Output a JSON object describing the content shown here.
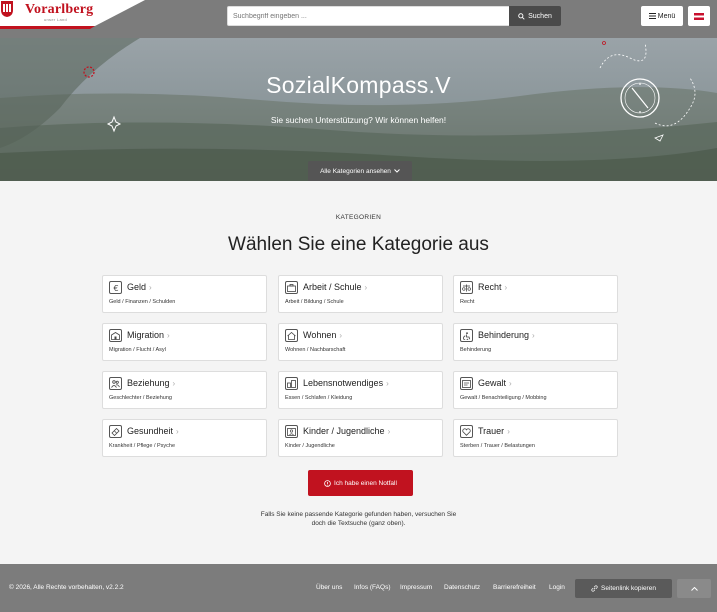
{
  "header": {
    "logo_text": "Vorarlberg",
    "logo_sub": "unser Land",
    "search_placeholder": "Suchbegriff eingeben ...",
    "search_button": "Suchen",
    "menu_label": "Menü"
  },
  "hero": {
    "title": "SozialKompass.V",
    "subtitle": "Sie suchen Unterstützung? Wir können helfen!",
    "categories_button": "Alle Kategorien ansehen"
  },
  "main": {
    "eyebrow": "KATEGORIEN",
    "heading": "Wählen Sie eine Kategorie aus",
    "categories": [
      {
        "title": "Geld",
        "sub": "Geld / Finanzen / Schulden",
        "icon": "euro-icon"
      },
      {
        "title": "Arbeit / Schule",
        "sub": "Arbeit / Bildung / Schule",
        "icon": "briefcase-icon"
      },
      {
        "title": "Recht",
        "sub": "Recht",
        "icon": "scales-icon"
      },
      {
        "title": "Migration",
        "sub": "Migration / Flucht / Asyl",
        "icon": "building-icon"
      },
      {
        "title": "Wohnen",
        "sub": "Wohnen / Nachbarschaft",
        "icon": "house-icon"
      },
      {
        "title": "Behinderung",
        "sub": "Behinderung",
        "icon": "accessibility-icon"
      },
      {
        "title": "Beziehung",
        "sub": "Geschlechter / Beziehung",
        "icon": "people-icon"
      },
      {
        "title": "Lebensnotwendiges",
        "sub": "Essen / Schlafen / Kleidung",
        "icon": "basket-icon"
      },
      {
        "title": "Gewalt",
        "sub": "Gewalt / Benachteiligung / Mobbing",
        "icon": "shield-icon"
      },
      {
        "title": "Gesundheit",
        "sub": "Krankheit / Pflege / Psyche",
        "icon": "health-icon"
      },
      {
        "title": "Kinder / Jugendliche",
        "sub": "Kinder / Jugendliche",
        "icon": "child-icon"
      },
      {
        "title": "Trauer",
        "sub": "Sterben / Trauer / Belastungen",
        "icon": "heart-icon"
      }
    ],
    "emergency_button": "Ich habe einen Notfall",
    "hint_line1": "Falls Sie keine passende Kategorie gefunden haben, versuchen Sie",
    "hint_line2": "doch die Textsuche (ganz oben)."
  },
  "footer": {
    "copyright": "© 2026, Alle Rechte vorbehalten, v2.2.2",
    "links": [
      "Über uns",
      "Infos (FAQs)",
      "Impressum",
      "Datenschutz",
      "Barrierefreiheit",
      "Login"
    ],
    "share_button": "Seitenlink kopieren"
  },
  "colors": {
    "brand_red": "#c1121f",
    "header_gray": "#7c7c7c"
  }
}
